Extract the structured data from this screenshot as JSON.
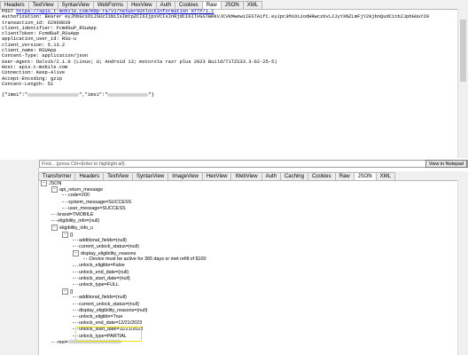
{
  "top_tabs": [
    "Headers",
    "TextView",
    "SyntaxView",
    "WebForms",
    "HexView",
    "Auth",
    "Cookies",
    "Raw",
    "JSON",
    "XML"
  ],
  "top_active": "Raw",
  "raw_request": {
    "method": "POST",
    "url": "https://apis.t-mobile.com/mdp-ra/v1/networkUnlockInformation HTTP/1.1",
    "headers": [
      "Authorization: Bearer eyJhbGciOiJSUzI1NiIsImtpZCI6IjpxVCIsInRjdCI6IlVGSTBRkVJCVkMwewiIESTAifC.eyJpc3MiOiJodHRwcz6vL2JyYXNZLmFjY29jbnQudC1tb2JpbGUuY29",
      "transaction_id: 62960839",
      "client_identifier: FcmdGuP_RSuApp",
      "clientToken: FcmdGuP_RSuApp",
      "application_user_id: RSU-u",
      "client_version: 5.13.2",
      "client_name: RSUApp",
      "Content-Type: application/json",
      "User-Agent: Dalvik/2.1.0 (Linux; U; Android 13; motorola razr plus 2023 Build/T1TZS33.3-62-25-5)",
      "Host: apis.t-mobile.com",
      "Connection: Keep-Alive",
      "Accept-Encoding: gzip",
      "Content-Length: 51"
    ],
    "body_prefix": "{\"imei\":\"",
    "body_mid": "\",\"imsi\":\"",
    "body_suffix": "\"}"
  },
  "find": {
    "placeholder": "Find... (press Ctrl+Enter to highlight all)",
    "button": "View in Notepad"
  },
  "bottom_tabs": [
    "Transformer",
    "Headers",
    "TextView",
    "SyntaxView",
    "ImageView",
    "HexView",
    "WebView",
    "Auth",
    "Caching",
    "Cookies",
    "Raw",
    "JSON",
    "XML"
  ],
  "bottom_active": "JSON",
  "tree": [
    {
      "d": 0,
      "t": "JSON",
      "e": "-"
    },
    {
      "d": 1,
      "t": "api_return_message",
      "e": "-"
    },
    {
      "d": 2,
      "t": "code=200"
    },
    {
      "d": 2,
      "t": "system_message=SUCCESS"
    },
    {
      "d": 2,
      "t": "user_message=SUCCESS"
    },
    {
      "d": 1,
      "t": "brand=TMOBILE"
    },
    {
      "d": 1,
      "t": "eligibility_info=(null)"
    },
    {
      "d": 1,
      "t": "eligibility_info_u",
      "e": "-"
    },
    {
      "d": 2,
      "t": "{}",
      "e": "-"
    },
    {
      "d": 3,
      "t": "additional_fields=(null)"
    },
    {
      "d": 3,
      "t": "current_unlock_status=(null)"
    },
    {
      "d": 3,
      "t": "display_eligibility_reasons",
      "e": "-"
    },
    {
      "d": 4,
      "t": "Device must be active for 365 days or met refill of $100"
    },
    {
      "d": 3,
      "t": "unlock_eligible=False"
    },
    {
      "d": 3,
      "t": "unlock_end_date=(null)"
    },
    {
      "d": 3,
      "t": "unlock_start_date=(null)"
    },
    {
      "d": 3,
      "t": "unlock_type=FULL"
    },
    {
      "d": 2,
      "t": "{}",
      "e": "-"
    },
    {
      "d": 3,
      "t": "additional_fields=(null)"
    },
    {
      "d": 3,
      "t": "current_unlock_status=(null)"
    },
    {
      "d": 3,
      "t": "display_eligibility_reasons=(null)"
    },
    {
      "d": 3,
      "t": "unlock_eligible=True"
    },
    {
      "d": 3,
      "t": "unlock_end_date=12/21/2023"
    },
    {
      "d": 3,
      "t": "unlock_start_date=11/21/2023"
    },
    {
      "d": 3,
      "t": "unlock_type=PARTIAL"
    },
    {
      "d": 1,
      "t": "mei=",
      "blur": true
    }
  ]
}
